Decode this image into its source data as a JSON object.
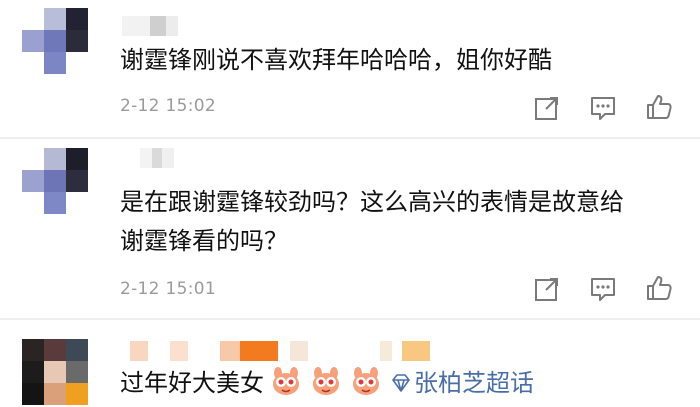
{
  "comments": [
    {
      "text": "谢霆锋刚说不喜欢拜年哈哈哈，姐你好酷",
      "time": "2-12 15:02"
    },
    {
      "text_line1": "是在跟谢霆锋较劲吗？这么高兴的表情是故意给",
      "text_line2": "谢霆锋看的吗？",
      "time": "2-12 15:01"
    },
    {
      "text": "过年好大美女",
      "emoji_count": 3,
      "topic": "张柏芝超话"
    }
  ],
  "icons": {
    "share": "share-icon",
    "reply": "comment-icon",
    "like": "thumbs-up-icon",
    "topic": "super-topic-diamond-icon",
    "emoji": "bunny-heart-emoji"
  },
  "colors": {
    "text": "#111111",
    "time": "#9a9a9a",
    "topic": "#4a6ea8",
    "icon": "#7a7a7a"
  }
}
